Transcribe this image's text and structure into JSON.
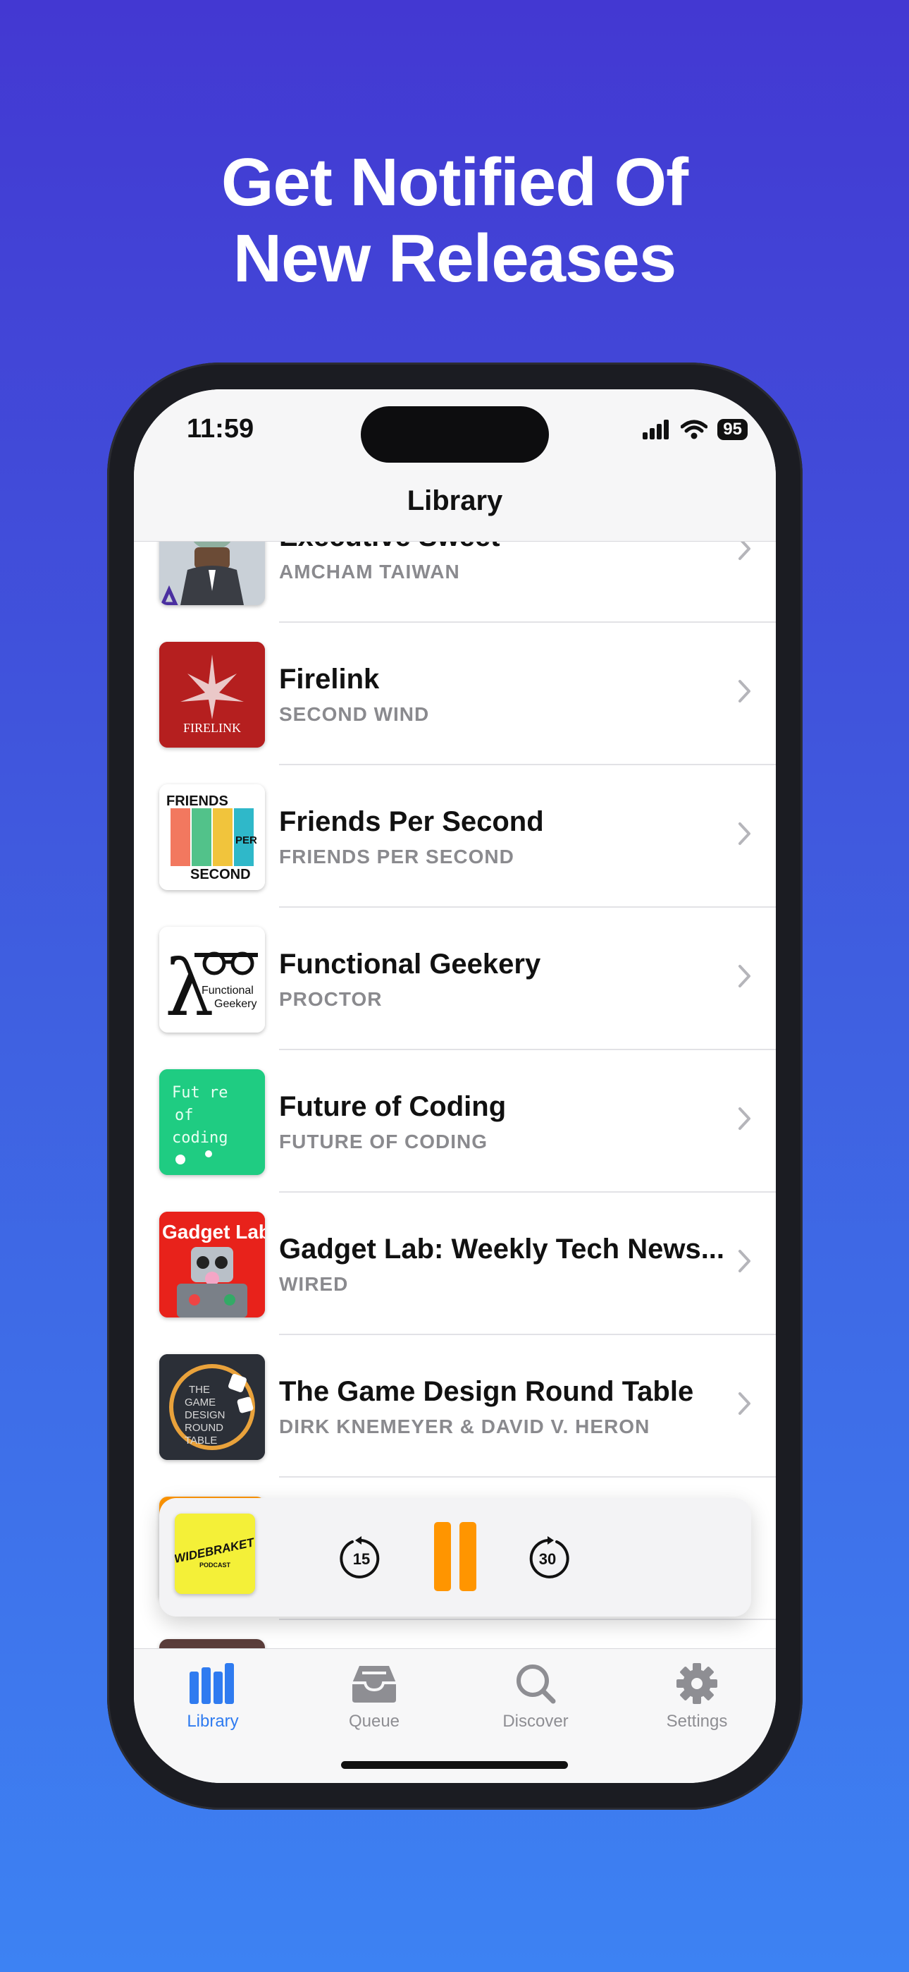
{
  "headline": {
    "line1": "Get Notified Of",
    "line2": "New Releases"
  },
  "status_bar": {
    "time": "11:59",
    "battery": "95"
  },
  "nav": {
    "title": "Library"
  },
  "podcasts": [
    {
      "title": "Executive Sweet",
      "author": "AMCHAM TAIWAN",
      "art_color": "#cfd6dc"
    },
    {
      "title": "Firelink",
      "author": "SECOND WIND",
      "art_color": "#b51f1f",
      "art_text": "FIRELINK"
    },
    {
      "title": "Friends Per Second",
      "author": "FRIENDS PER SECOND",
      "art_color": "#ffffff",
      "art_text_top": "FRIENDS",
      "art_text_mid": "PER",
      "art_text_bottom": "SECOND"
    },
    {
      "title": "Functional Geekery",
      "author": "PROCTOR",
      "art_color": "#ffffff",
      "art_text": "Functional Geekery"
    },
    {
      "title": "Future of Coding",
      "author": "FUTURE OF CODING",
      "art_color": "#1fcc82",
      "art_text": "Fut re of coding"
    },
    {
      "title": "Gadget Lab: Weekly Tech News...",
      "author": "WIRED",
      "art_color": "#e8221b",
      "art_text": "Gadget Lab"
    },
    {
      "title": "The Game Design Round Table",
      "author": "DIRK KNEMEYER & DAVID V. HERON",
      "art_color": "#2b2f37",
      "art_text": "THE GAME DESIGN ROUND TABLE"
    }
  ],
  "player": {
    "art_text": "WIDEBRAKET",
    "art_subtext": "PODCAST",
    "skip_back": "15",
    "skip_forward": "30",
    "accent": "#ff9500"
  },
  "tabs": [
    {
      "label": "Library",
      "icon": "library-icon",
      "active": true
    },
    {
      "label": "Queue",
      "icon": "inbox-icon",
      "active": false
    },
    {
      "label": "Discover",
      "icon": "search-icon",
      "active": false
    },
    {
      "label": "Settings",
      "icon": "gear-icon",
      "active": false
    }
  ],
  "colors": {
    "accent_blue": "#2f7bf0",
    "inactive_gray": "#8e8e93"
  }
}
